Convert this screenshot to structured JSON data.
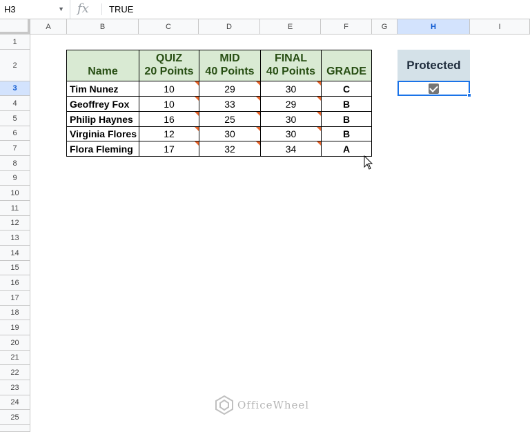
{
  "formula_bar": {
    "cell_ref": "H3",
    "fx_symbol": "fx",
    "value": "TRUE"
  },
  "columns": [
    "A",
    "B",
    "C",
    "D",
    "E",
    "F",
    "G",
    "H",
    "I"
  ],
  "rows": [
    "1",
    "2",
    "3",
    "4",
    "5",
    "6",
    "7",
    "8",
    "9",
    "10",
    "11",
    "12",
    "13",
    "14",
    "15",
    "16",
    "17",
    "18",
    "19",
    "20",
    "21",
    "22",
    "23",
    "24",
    "25"
  ],
  "selected": {
    "column": "H",
    "row": "3"
  },
  "table": {
    "headers": {
      "name": "Name",
      "quiz": [
        "QUIZ",
        "20 Points"
      ],
      "mid": [
        "MID",
        "40 Points"
      ],
      "final": [
        "FINAL",
        "40 Points"
      ],
      "grade": "GRADE"
    },
    "rows": [
      {
        "name": "Tim Nunez",
        "quiz": "10",
        "mid": "29",
        "final": "30",
        "grade": "C"
      },
      {
        "name": "Geoffrey Fox",
        "quiz": "10",
        "mid": "33",
        "final": "29",
        "grade": "B"
      },
      {
        "name": "Philip Haynes",
        "quiz": "16",
        "mid": "25",
        "final": "30",
        "grade": "B"
      },
      {
        "name": "Virginia Flores",
        "quiz": "12",
        "mid": "30",
        "final": "30",
        "grade": "B"
      },
      {
        "name": "Flora Fleming",
        "quiz": "17",
        "mid": "32",
        "final": "34",
        "grade": "A"
      }
    ]
  },
  "protected_label": "Protected",
  "checkbox_checked": true,
  "watermark": "OfficeWheel",
  "colors": {
    "header_fill": "#d9ead3",
    "header_text": "#274e13",
    "protected_fill": "#d4e1e8",
    "note_marker": "#e8642a",
    "selection": "#1a73e8"
  }
}
